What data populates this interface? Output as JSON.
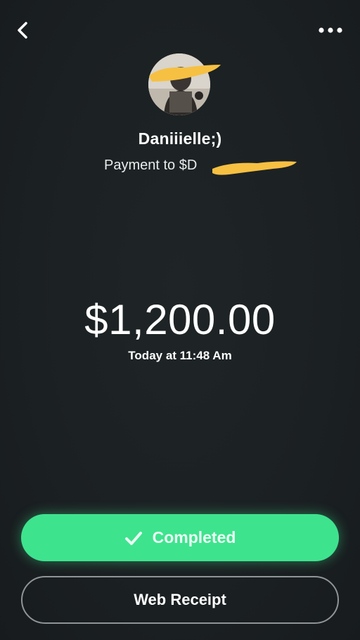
{
  "header": {
    "back_icon": "chevron-left-icon",
    "more_icon": "more-horizontal-icon"
  },
  "recipient": {
    "name": "Daniiielle;)",
    "payment_prefix": "Payment to",
    "handle_visible": "$D"
  },
  "transaction": {
    "amount": "$1,200.00",
    "timestamp": "Today at 11:48 Am"
  },
  "status": {
    "label": "Completed",
    "icon": "checkmark-icon",
    "color": "#3ee38e"
  },
  "receipt": {
    "label": "Web Receipt"
  },
  "colors": {
    "background": "#1b2022",
    "accent": "#3ee38e",
    "redaction": "#f6c042"
  }
}
